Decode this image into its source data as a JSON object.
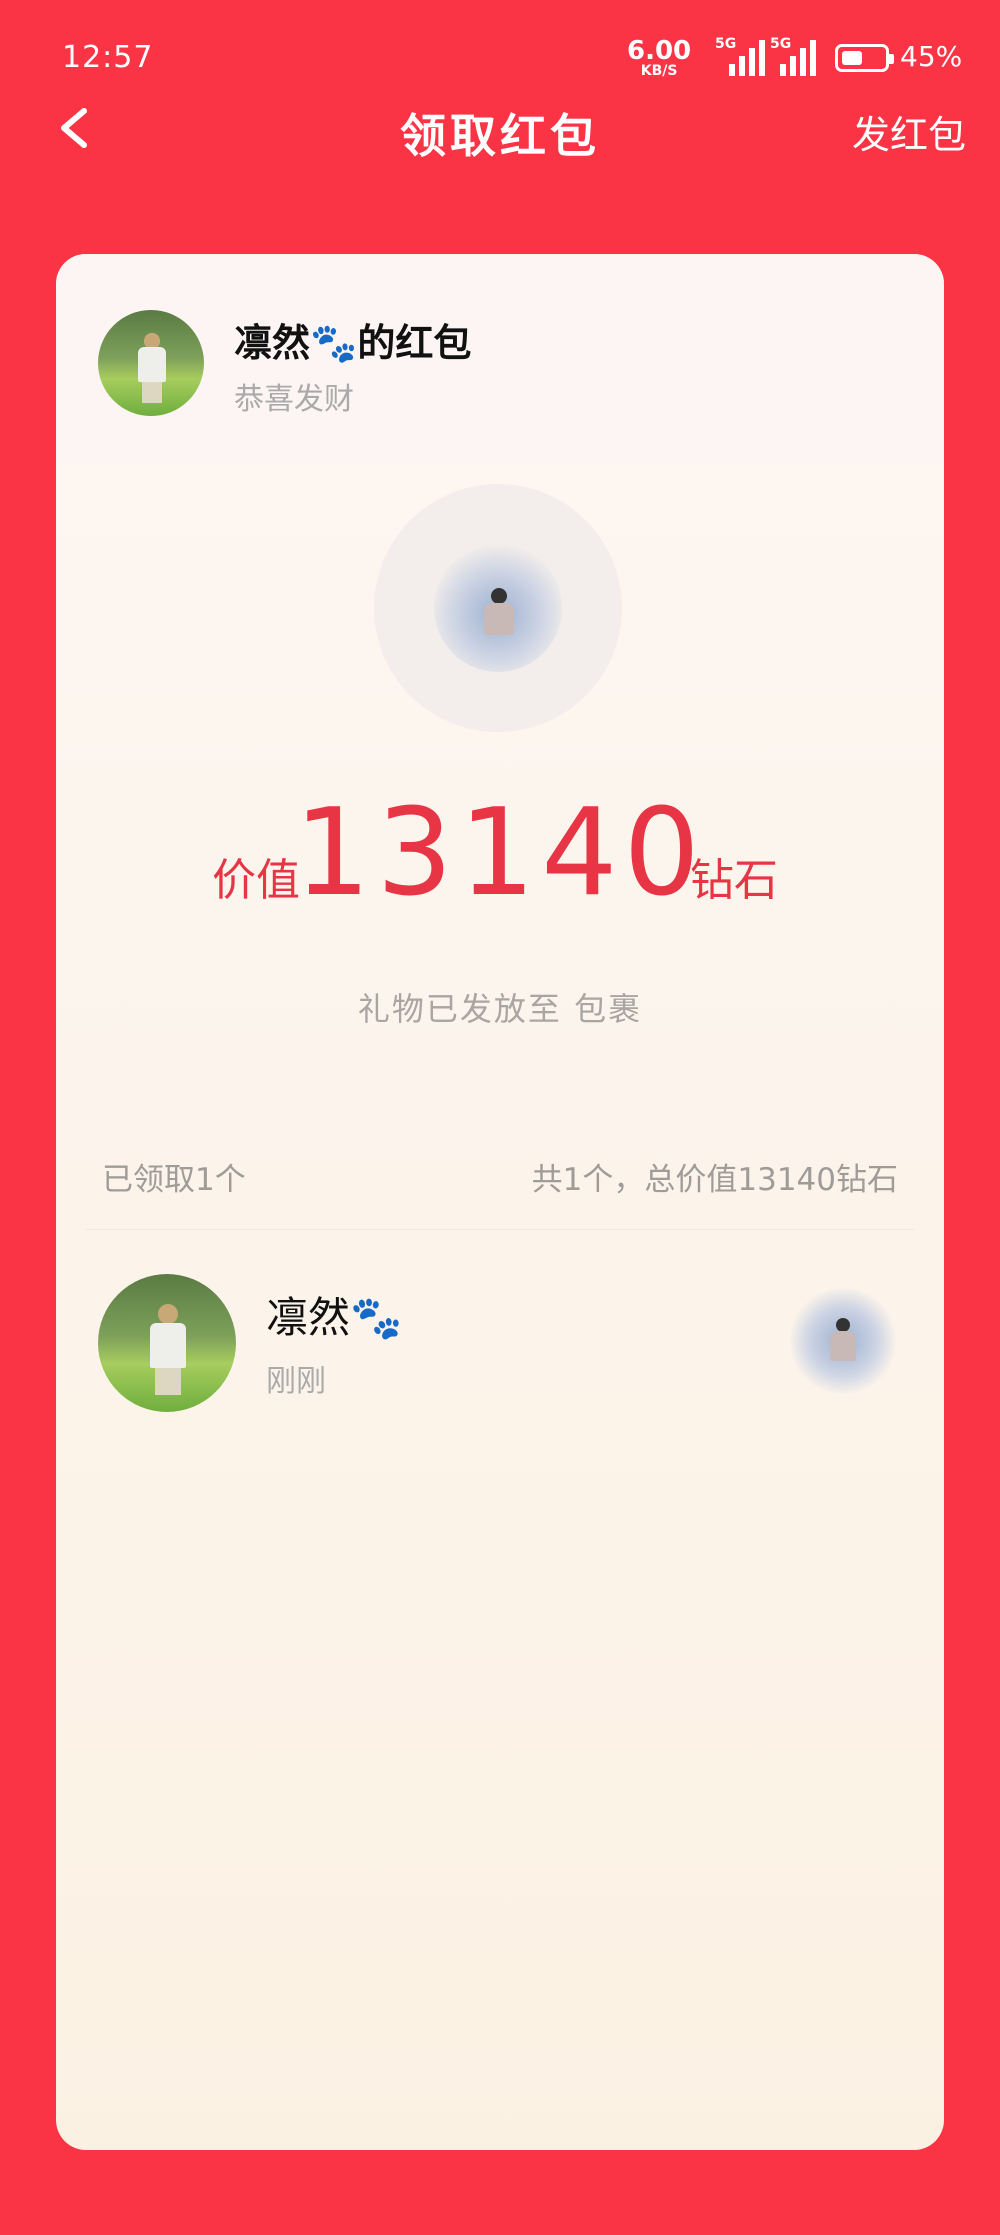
{
  "status_bar": {
    "time": "12:57",
    "net_speed": "6.00",
    "net_unit": "KB/S",
    "signal_1": "5G",
    "signal_2": "5G",
    "battery_pct": "45%",
    "battery_level": 0.45
  },
  "nav": {
    "title": "领取红包",
    "action": "发红包",
    "back_icon": "chevron-left-icon"
  },
  "colors": {
    "background": "#fb3445",
    "card": "#fdf7f3",
    "accent_red": "#e83545"
  },
  "card": {
    "sender": {
      "name": "凛然🐾的红包",
      "greeting": "恭喜发财"
    },
    "gift_icon": "gift-image",
    "value": {
      "prefix": "价值",
      "amount": "13140",
      "unit": "钻石"
    },
    "delivered_note": "礼物已发放至 包裹",
    "summary": {
      "claimed": "已领取1个",
      "total": "共1个，总价值13140钻石"
    },
    "receivers": [
      {
        "name": "凛然🐾",
        "time": "刚刚"
      }
    ]
  }
}
